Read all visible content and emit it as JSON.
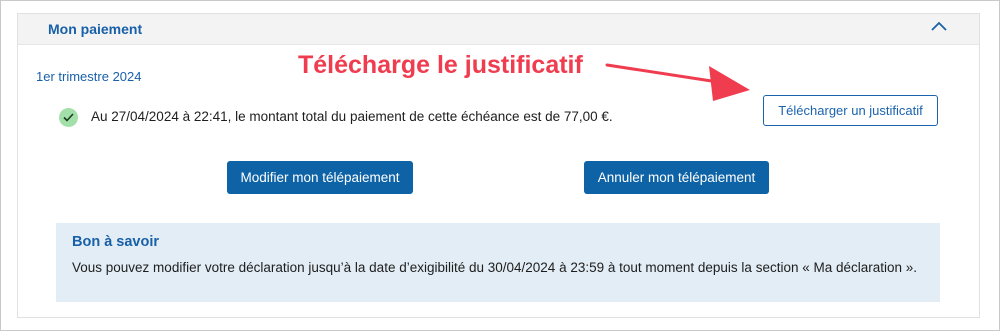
{
  "panel": {
    "title": "Mon paiement",
    "toggle_icon": "chevron-up-icon"
  },
  "payment": {
    "period": "1er trimestre 2024",
    "status_icon": "check-circle-icon",
    "status_text": "Au 27/04/2024 à 22:41, le montant total du paiement de cette échéance est de 77,00 €.",
    "download_label": "Télécharger un justificatif"
  },
  "actions": {
    "modify_label": "Modifier mon télépaiement",
    "cancel_label": "Annuler mon télépaiement"
  },
  "info": {
    "title": "Bon à savoir",
    "text": "Vous pouvez modifier votre déclaration jusqu’à la date d’exigibilité du 30/04/2024 à 23:59 à tout moment depuis la section « Ma déclaration »."
  },
  "annotation": {
    "text": "Télécharge le justificatif",
    "color": "#f03c4f",
    "arrow_icon": "arrow-right-icon"
  },
  "colors": {
    "primary": "#0e63a6",
    "link": "#1860a8",
    "success": "#a3e0a9",
    "info_bg": "#e3edf5"
  }
}
